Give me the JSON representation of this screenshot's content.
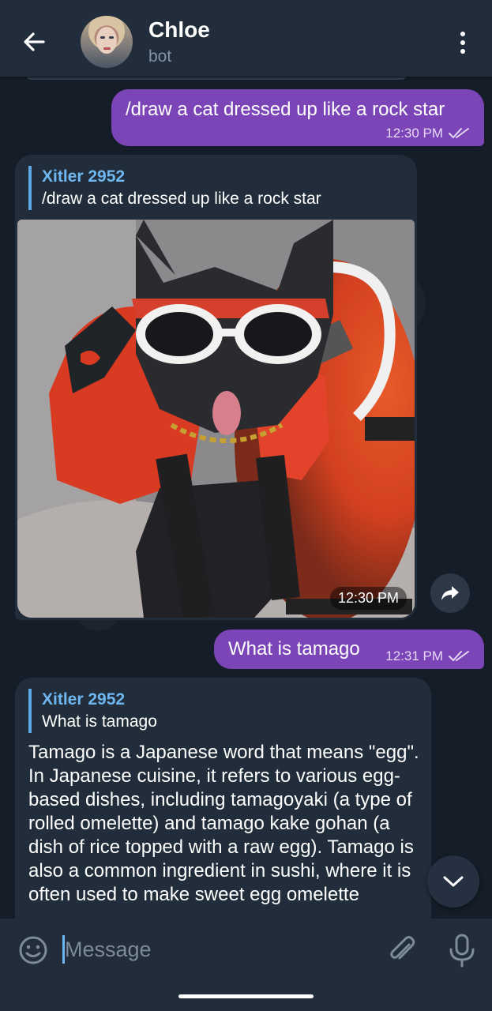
{
  "header": {
    "title": "Chloe",
    "subtitle": "bot"
  },
  "messages": {
    "out1": {
      "text": "/draw a cat dressed up like a rock star",
      "time": "12:30 PM"
    },
    "in1": {
      "reply_name": "Xitler 2952",
      "reply_text": "/draw a cat dressed up like a rock star",
      "photo_time": "12:30 PM"
    },
    "out2": {
      "text": "What is tamago",
      "time": "12:31 PM"
    },
    "in2": {
      "reply_name": "Xitler 2952",
      "reply_text": "What is tamago",
      "text": "Tamago is a Japanese word that means \"egg\". In Japanese cuisine, it refers to various egg-based dishes, including tamagoyaki (a type of rolled omelette) and tamago kake gohan (a dish of rice topped with a raw egg). Tamago is also a common ingredient in sushi, where it is often used to make sweet egg omelette"
    }
  },
  "composer": {
    "placeholder": "Message"
  },
  "colors": {
    "outgoing": "#7b45b8",
    "incoming": "#212d3b",
    "accent": "#6eb7f0"
  },
  "icons": [
    "back-arrow-icon",
    "more-vert-icon",
    "double-check-icon",
    "share-icon",
    "chevron-down-icon",
    "emoji-icon",
    "paperclip-icon",
    "microphone-icon"
  ]
}
